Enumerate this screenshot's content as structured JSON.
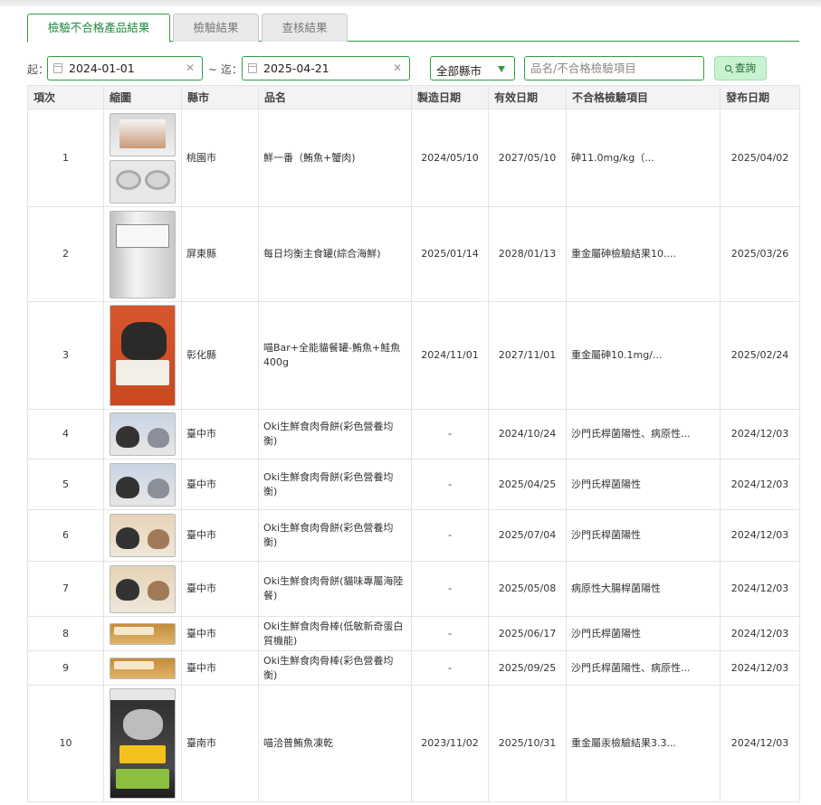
{
  "tabs": [
    {
      "label": "檢驗不合格產品結果",
      "active": true
    },
    {
      "label": "檢驗結果",
      "active": false
    },
    {
      "label": "查核結果",
      "active": false
    }
  ],
  "filters": {
    "start_label": "起：",
    "start_date": "2024-01-01",
    "range_sep": "~ 迄：",
    "end_date": "2025-04-21",
    "clear_icon": "✕",
    "county_value": "全部縣市",
    "search_placeholder": "品名/不合格檢驗項目",
    "search_value": "",
    "query_label": "查詢"
  },
  "table": {
    "headers": [
      "項次",
      "縮圖",
      "縣市",
      "品名",
      "製造日期",
      "有效日期",
      "不合格檢驗項目",
      "發布日期"
    ],
    "rows": [
      {
        "no": "1",
        "county": "桃園市",
        "name": "鮮一番（鮪魚+蟹肉)",
        "mfg": "2024/05/10",
        "exp": "2027/05/10",
        "item": "砷11.0mg/kg（...",
        "pub": "2025/04/02",
        "thumbs": [
          "can-icon",
          "tray-icon"
        ]
      },
      {
        "no": "2",
        "county": "屏東縣",
        "name": "每日均衡主食罐(綜合海鮮)",
        "mfg": "2025/01/14",
        "exp": "2028/01/13",
        "item": "重金屬砷檢驗結果10....",
        "pub": "2025/03/26",
        "thumbs": [
          "silver-can-icon"
        ]
      },
      {
        "no": "3",
        "county": "彰化縣",
        "name": "喵Bar+全能貓餐罐-鮪魚+鮭魚400g",
        "mfg": "2024/11/01",
        "exp": "2027/11/01",
        "item": "重金屬砷10.1mg/...",
        "pub": "2025/02/24",
        "thumbs": [
          "orange-can-icon"
        ]
      },
      {
        "no": "4",
        "county": "臺中市",
        "name": "Oki生鮮食肉骨餅(彩色營養均衡)",
        "mfg": "-",
        "exp": "2024/10/24",
        "item": "沙門氏桿菌陽性、病原性...",
        "pub": "2024/12/03",
        "thumbs": [
          "pet-pack-icon"
        ]
      },
      {
        "no": "5",
        "county": "臺中市",
        "name": "Oki生鮮食肉骨餅(彩色營養均衡)",
        "mfg": "-",
        "exp": "2025/04/25",
        "item": "沙門氏桿菌陽性",
        "pub": "2024/12/03",
        "thumbs": [
          "pet-pack-icon"
        ]
      },
      {
        "no": "6",
        "county": "臺中市",
        "name": "Oki生鮮食肉骨餅(彩色營養均衡)",
        "mfg": "-",
        "exp": "2025/07/04",
        "item": "沙門氏桿菌陽性",
        "pub": "2024/12/03",
        "thumbs": [
          "pet-pack-beige-icon"
        ]
      },
      {
        "no": "7",
        "county": "臺中市",
        "name": "Oki生鮮食肉骨餅(貓味專屬海陸餐)",
        "mfg": "-",
        "exp": "2025/05/08",
        "item": "病原性大腸桿菌陽性",
        "pub": "2024/12/03",
        "thumbs": [
          "pet-pack-beige-icon"
        ]
      },
      {
        "no": "8",
        "county": "臺中市",
        "name": "Oki生鮮食肉骨棒(低敏新奇蛋白質機能)",
        "mfg": "-",
        "exp": "2025/06/17",
        "item": "沙門氏桿菌陽性",
        "pub": "2024/12/03",
        "thumbs": [
          "stick-pack-icon"
        ]
      },
      {
        "no": "9",
        "county": "臺中市",
        "name": "Oki生鮮食肉骨棒(彩色營養均衡)",
        "mfg": "-",
        "exp": "2025/09/25",
        "item": "沙門氏桿菌陽性、病原性...",
        "pub": "2024/12/03",
        "thumbs": [
          "stick-pack-icon"
        ]
      },
      {
        "no": "10",
        "county": "臺南市",
        "name": "喵洽普鮪魚凍乾",
        "mfg": "2023/11/02",
        "exp": "2025/10/31",
        "item": "重金屬汞檢驗結果3.3...",
        "pub": "2024/12/03",
        "thumbs": [
          "jar-icon"
        ]
      }
    ]
  }
}
